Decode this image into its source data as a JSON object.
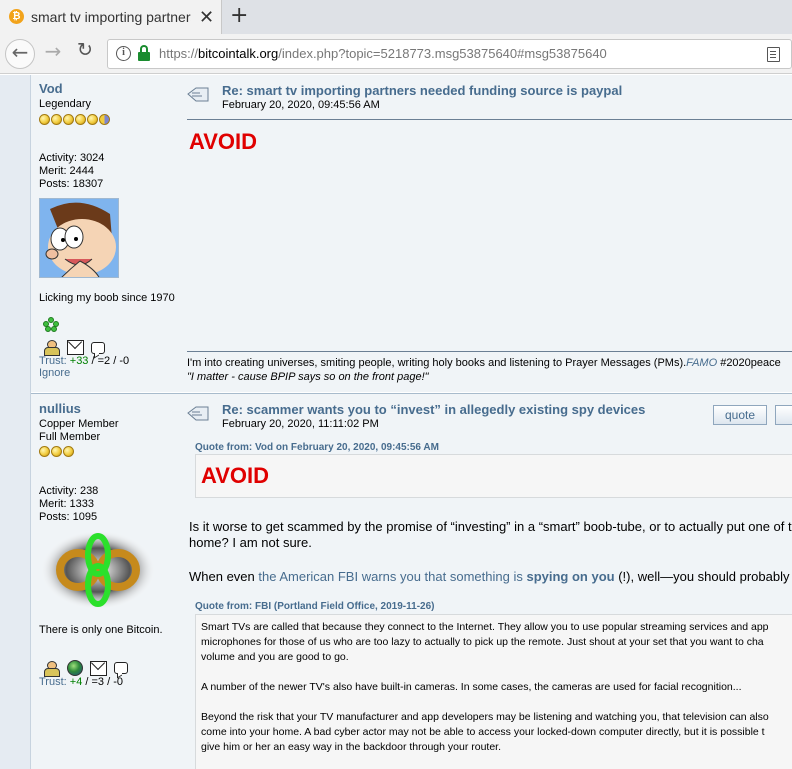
{
  "browser": {
    "tab_title": "smart tv importing partners needed funding source is paypal",
    "url_prefix": "https://",
    "url_host": "bitcointalk.org",
    "url_path": "/index.php?topic=5218773.msg53875640#msg53875640"
  },
  "posts": [
    {
      "author": "Vod",
      "rank": "Legendary",
      "activity": "Activity: 3024",
      "merit": "Merit: 2444",
      "posts": "Posts: 18307",
      "personal_text": "Licking my boob since 1970",
      "trust_label": "Trust: ",
      "trust_pos": "+33",
      "trust_rest": " / =2 / -0",
      "ignore": "Ignore",
      "subject": "Re: smart tv importing partners needed funding source is paypal",
      "date": "February 20, 2020, 09:45:56 AM",
      "body": "AVOID",
      "signature_line1": "I'm into creating universes, smiting people, writing holy books and listening to Prayer Messages (PMs).",
      "signature_link": "FAMO",
      "signature_tag": "  #2020peace",
      "signature_line2": "\"I matter - cause BPIP says so on the front page!\""
    },
    {
      "author": "nullius",
      "rank": "Copper Member",
      "rank2": "Full Member",
      "activity": "Activity: 238",
      "merit": "Merit: 1333",
      "posts": "Posts: 1095",
      "personal_text": "There is only one Bitcoin.",
      "trust_label": "Trust: ",
      "trust_pos": "+4",
      "trust_rest": " / =3 / -0",
      "subject": "Re: scammer wants you to “invest” in allegedly existing spy devices",
      "date": "February 20, 2020, 11:11:02 PM",
      "quote_button": "quote",
      "quote1_header": "Quote from: Vod on February 20, 2020, 09:45:56 AM",
      "quote1_body": "AVOID",
      "para1_line1": "Is it worse to get scammed by the promise of “investing” in a “smart” boob-tube, or to actually put one of t",
      "para1_line2": "home?  I am not sure.",
      "para2_start": "When even ",
      "para2_link": "the American FBI warns you that something is",
      "para2_bold": "spying on you",
      "para2_end": " (!), well—you should probably",
      "quote2_header": "Quote from: FBI (Portland Field Office, 2019-11-26)",
      "quote2_lines": [
        "Smart TVs are called that because they connect to the Internet. They allow you to use popular streaming services and app",
        "microphones for those of us who are too lazy to actually to pick up the remote. Just shout at your set that you want to cha",
        "volume and you are good to go.",
        "",
        "A number of the newer TV's also have built-in cameras. In some cases, the cameras are used for facial recognition...",
        "",
        "Beyond the risk that your TV manufacturer and app developers may be listening and watching you, that television can also",
        "come into your home. A bad cyber actor may not be able to access your locked-down computer directly, but it is possible t",
        "give him or her an easy way in the backdoor through your router."
      ]
    }
  ]
}
